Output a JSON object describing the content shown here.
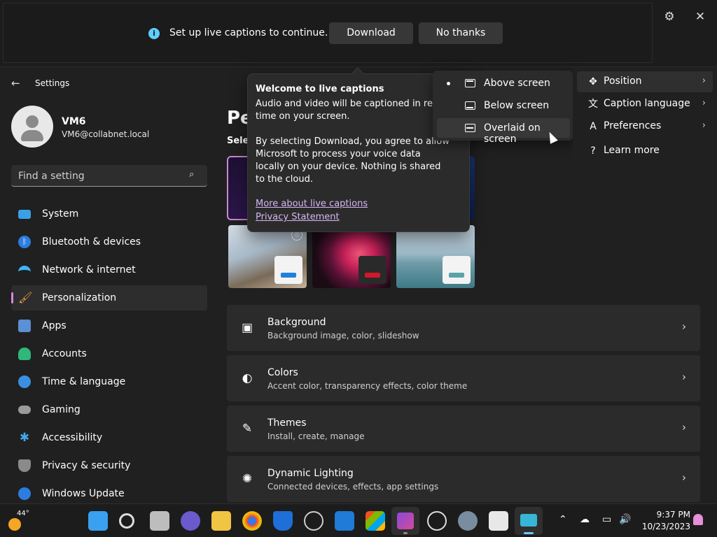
{
  "captions_bar": {
    "message": "Set up live captions to continue.",
    "download_label": "Download",
    "no_thanks_label": "No thanks"
  },
  "window": {
    "title": "Settings"
  },
  "user": {
    "name": "VM6",
    "email": "VM6@collabnet.local"
  },
  "search": {
    "placeholder": "Find a setting"
  },
  "sidebar": {
    "items": [
      {
        "label": "System",
        "icon": "system-icon",
        "color": "#3aa0e6"
      },
      {
        "label": "Bluetooth & devices",
        "icon": "bluetooth-icon",
        "color": "#2b7de0"
      },
      {
        "label": "Network & internet",
        "icon": "wifi-icon",
        "color": "#41b3f5"
      },
      {
        "label": "Personalization",
        "icon": "brush-icon",
        "color": "#e8a042",
        "active": true
      },
      {
        "label": "Apps",
        "icon": "apps-icon",
        "color": "#5b8fd6"
      },
      {
        "label": "Accounts",
        "icon": "accounts-icon",
        "color": "#2fb87a"
      },
      {
        "label": "Time & language",
        "icon": "clock-globe-icon",
        "color": "#3a8fe0"
      },
      {
        "label": "Gaming",
        "icon": "gamepad-icon",
        "color": "#9a9a9a"
      },
      {
        "label": "Accessibility",
        "icon": "accessibility-icon",
        "color": "#41a8f0"
      },
      {
        "label": "Privacy & security",
        "icon": "shield-icon",
        "color": "#8a8a8a"
      },
      {
        "label": "Windows Update",
        "icon": "update-icon",
        "color": "#2b7de0"
      }
    ]
  },
  "page": {
    "title": "Pe",
    "subtitle": "Selec"
  },
  "cards": [
    {
      "title": "Background",
      "desc": "Background image, color, slideshow",
      "icon": "image-icon"
    },
    {
      "title": "Colors",
      "desc": "Accent color, transparency effects, color theme",
      "icon": "palette-icon"
    },
    {
      "title": "Themes",
      "desc": "Install, create, manage",
      "icon": "pen-icon"
    },
    {
      "title": "Dynamic Lighting",
      "desc": "Connected devices, effects, app settings",
      "icon": "sparkle-icon"
    }
  ],
  "welcome": {
    "title": "Welcome to live captions",
    "p1a": "Audio and video will be captioned in real",
    "p1b": "time on your screen.",
    "p2a": "By selecting Download, you agree to allow",
    "p2b": "Microsoft to process your voice data",
    "p2c": "locally on your device. Nothing is shared",
    "p2d": "to the cloud.",
    "link1": "More about live captions",
    "link2": "Privacy Statement"
  },
  "position_menu": {
    "items": [
      {
        "label": "Above screen",
        "selected": true
      },
      {
        "label": "Below screen",
        "selected": false
      },
      {
        "label": "Overlaid on screen",
        "selected": false,
        "hover": true
      }
    ]
  },
  "caption_menu": {
    "items": [
      {
        "label": "Position",
        "icon": "move-icon",
        "has_submenu": true
      },
      {
        "label": "Caption language",
        "icon": "language-icon",
        "has_submenu": true
      },
      {
        "label": "Preferences",
        "icon": "text-style-icon",
        "has_submenu": true
      },
      {
        "label": "Learn more",
        "icon": "help-icon",
        "has_submenu": false
      }
    ]
  },
  "taskbar": {
    "temperature": "44°",
    "time": "9:37 PM",
    "date": "10/23/2023"
  }
}
